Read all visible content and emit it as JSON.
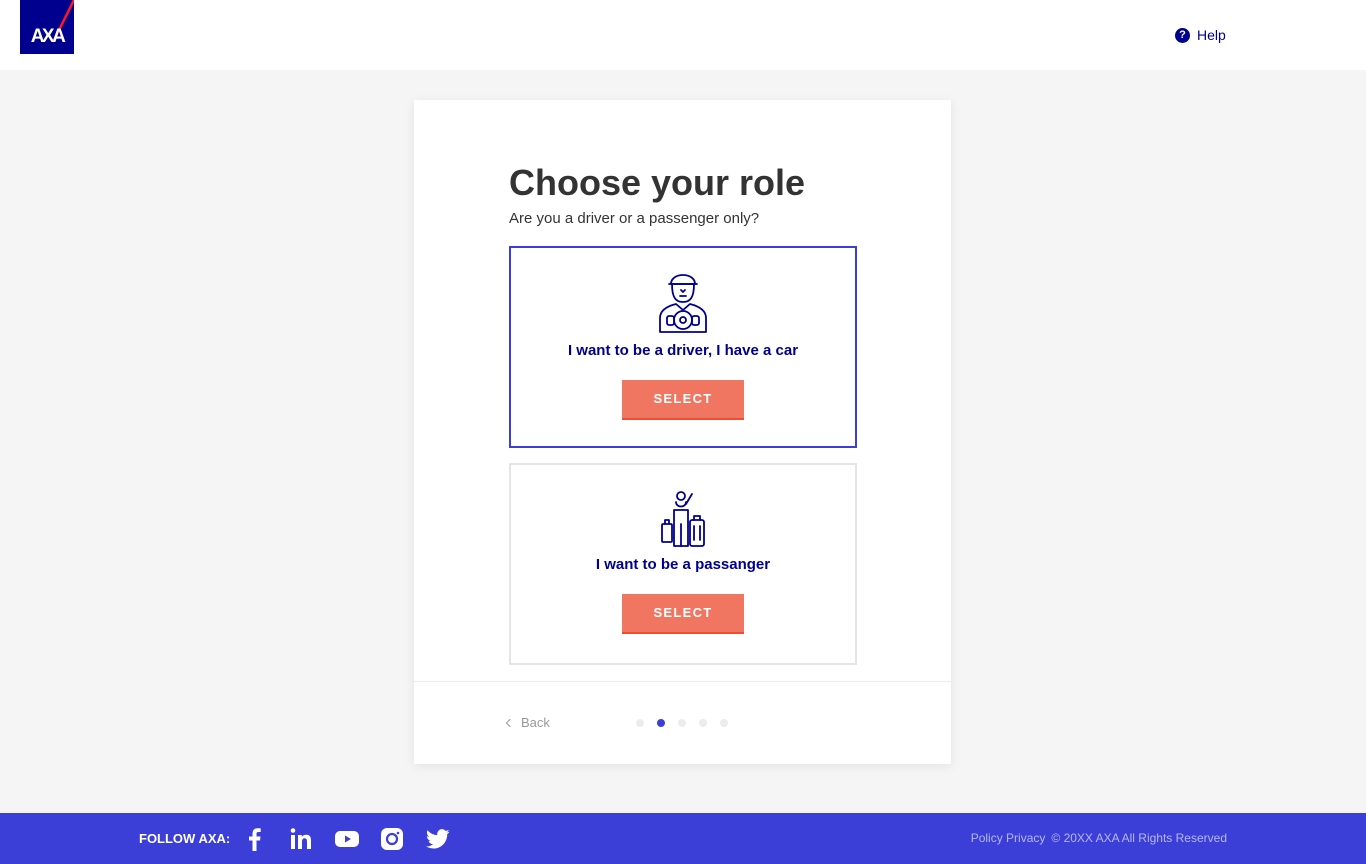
{
  "header": {
    "logo_text": "AXA",
    "help_label": "Help",
    "help_icon_glyph": "?"
  },
  "card": {
    "title": "Choose your role",
    "subtitle": "Are you a driver or a passenger only?",
    "options": [
      {
        "label": "I want to be a driver, I have a car",
        "button": "SELECT",
        "selected": true,
        "icon": "driver-icon"
      },
      {
        "label": "I want to be a passanger",
        "button": "SELECT",
        "selected": false,
        "icon": "passenger-icon"
      }
    ],
    "back_label": "Back",
    "steps": {
      "total": 5,
      "current": 2
    }
  },
  "footer": {
    "follow_label": "FOLLOW AXA:",
    "social": [
      "facebook-icon",
      "linkedin-icon",
      "youtube-icon",
      "instagram-icon",
      "twitter-icon"
    ],
    "policy_label": "Policy Privacy",
    "copyright": "© 20XX AXA All Rights Reserved"
  },
  "colors": {
    "brand_blue": "#00008f",
    "accent_blue": "#3b3fd8",
    "button_coral": "#f07662",
    "background": "#f5f5f5"
  }
}
